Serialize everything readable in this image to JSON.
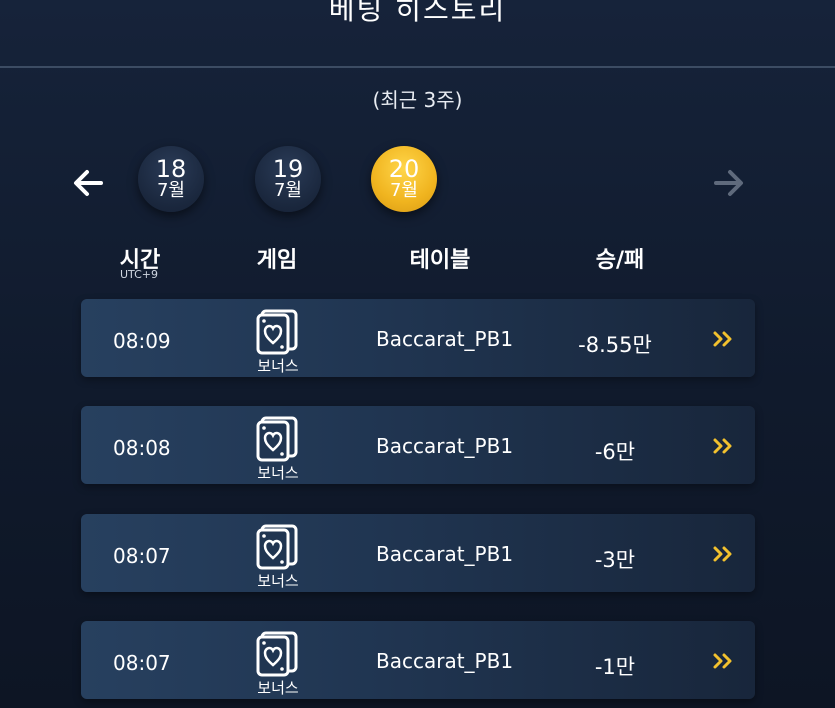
{
  "header": {
    "title": "베팅 히스토리"
  },
  "subtitle": "(최근 3주)",
  "dates": [
    {
      "day": "18",
      "month": "7월",
      "active": false
    },
    {
      "day": "19",
      "month": "7월",
      "active": false
    },
    {
      "day": "20",
      "month": "7월",
      "active": true
    }
  ],
  "columns": {
    "time": "시간",
    "time_sub": "UTC+9",
    "game": "게임",
    "table": "테이블",
    "result": "승/패"
  },
  "rows": [
    {
      "time": "08:09",
      "game": "보너스",
      "table": "Baccarat_PB1",
      "result": "-8.55만"
    },
    {
      "time": "08:08",
      "game": "보너스",
      "table": "Baccarat_PB1",
      "result": "-6만"
    },
    {
      "time": "08:07",
      "game": "보너스",
      "table": "Baccarat_PB1",
      "result": "-3만"
    },
    {
      "time": "08:07",
      "game": "보너스",
      "table": "Baccarat_PB1",
      "result": "-1만"
    }
  ],
  "colors": {
    "accent_gold": "#f2bc27",
    "row_arrow": "#f2c12e",
    "disabled_arrow": "#5f6a7c"
  },
  "icons": {
    "back": "arrow-left-icon",
    "forward": "arrow-right-icon",
    "game": "bonus-card-icon",
    "detail": "double-chevron-right-icon"
  }
}
